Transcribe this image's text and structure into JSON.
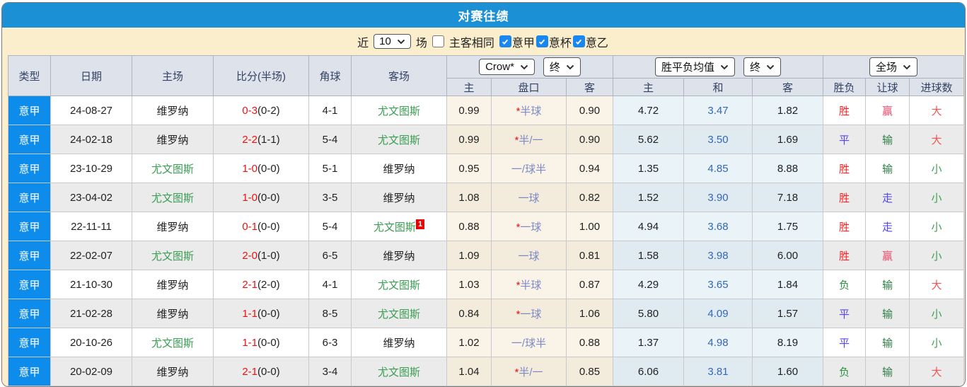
{
  "title": "对赛往绩",
  "filter": {
    "recent_label": "近",
    "count_value": "10",
    "matches_label": "场",
    "same_venue": {
      "label": "主客相同",
      "checked": false
    },
    "leagues": [
      {
        "label": "意甲",
        "checked": true
      },
      {
        "label": "意杯",
        "checked": true
      },
      {
        "label": "意乙",
        "checked": true
      }
    ]
  },
  "table": {
    "headers": {
      "type": "类型",
      "date": "日期",
      "home": "主场",
      "score": "比分(半场)",
      "corners": "角球",
      "away": "客场",
      "odds_company_select": "Crow*",
      "odds_time_select": "终",
      "odds_sub_home": "主",
      "odds_sub_handicap": "盘口",
      "odds_sub_away": "客",
      "avg_select": "胜平负均值",
      "avg_time_select": "终",
      "avg_sub_home": "主",
      "avg_sub_draw": "和",
      "avg_sub_away": "客",
      "scope_select": "全场",
      "result_sub_wl": "胜负",
      "result_sub_handicap": "让球",
      "result_sub_goals": "进球数"
    },
    "rows": [
      {
        "league": "意甲",
        "date": "24-08-27",
        "home": "维罗纳",
        "home_highlight": false,
        "score_ft": "0-3",
        "score_ht": "(0-2)",
        "corners": "4-1",
        "away": "尤文图斯",
        "away_highlight": true,
        "away_note": null,
        "odds_home": "0.99",
        "handicap_star": true,
        "handicap": "半球",
        "odds_away": "0.90",
        "avg_home": "4.72",
        "avg_draw": "3.47",
        "avg_away": "1.82",
        "result": "胜",
        "handicap_result": "赢",
        "goals": "大"
      },
      {
        "league": "意甲",
        "date": "24-02-18",
        "home": "维罗纳",
        "home_highlight": false,
        "score_ft": "2-2",
        "score_ht": "(1-1)",
        "corners": "5-4",
        "away": "尤文图斯",
        "away_highlight": true,
        "away_note": null,
        "odds_home": "0.99",
        "handicap_star": true,
        "handicap": "半/一",
        "odds_away": "0.90",
        "avg_home": "5.62",
        "avg_draw": "3.50",
        "avg_away": "1.69",
        "result": "平",
        "handicap_result": "输",
        "goals": "大"
      },
      {
        "league": "意甲",
        "date": "23-10-29",
        "home": "尤文图斯",
        "home_highlight": true,
        "score_ft": "1-0",
        "score_ht": "(0-0)",
        "corners": "5-1",
        "away": "维罗纳",
        "away_highlight": false,
        "away_note": null,
        "odds_home": "0.95",
        "handicap_star": false,
        "handicap": "一/球半",
        "odds_away": "0.94",
        "avg_home": "1.35",
        "avg_draw": "4.85",
        "avg_away": "8.88",
        "result": "胜",
        "handicap_result": "输",
        "goals": "小"
      },
      {
        "league": "意甲",
        "date": "23-04-02",
        "home": "尤文图斯",
        "home_highlight": true,
        "score_ft": "1-0",
        "score_ht": "(0-0)",
        "corners": "3-5",
        "away": "维罗纳",
        "away_highlight": false,
        "away_note": null,
        "odds_home": "1.08",
        "handicap_star": false,
        "handicap": "一球",
        "odds_away": "0.82",
        "avg_home": "1.52",
        "avg_draw": "3.90",
        "avg_away": "7.18",
        "result": "胜",
        "handicap_result": "走",
        "goals": "小"
      },
      {
        "league": "意甲",
        "date": "22-11-11",
        "home": "维罗纳",
        "home_highlight": false,
        "score_ft": "0-1",
        "score_ht": "(0-0)",
        "corners": "5-4",
        "away": "尤文图斯",
        "away_highlight": true,
        "away_note": "1",
        "odds_home": "0.88",
        "handicap_star": true,
        "handicap": "一球",
        "odds_away": "1.00",
        "avg_home": "4.94",
        "avg_draw": "3.68",
        "avg_away": "1.75",
        "result": "胜",
        "handicap_result": "走",
        "goals": "小"
      },
      {
        "league": "意甲",
        "date": "22-02-07",
        "home": "尤文图斯",
        "home_highlight": true,
        "score_ft": "2-0",
        "score_ht": "(1-0)",
        "corners": "6-5",
        "away": "维罗纳",
        "away_highlight": false,
        "away_note": null,
        "odds_home": "1.09",
        "handicap_star": false,
        "handicap": "一球",
        "odds_away": "0.81",
        "avg_home": "1.58",
        "avg_draw": "3.98",
        "avg_away": "6.00",
        "result": "胜",
        "handicap_result": "赢",
        "goals": "小"
      },
      {
        "league": "意甲",
        "date": "21-10-30",
        "home": "维罗纳",
        "home_highlight": false,
        "score_ft": "2-1",
        "score_ht": "(2-0)",
        "corners": "4-1",
        "away": "尤文图斯",
        "away_highlight": true,
        "away_note": null,
        "odds_home": "1.03",
        "handicap_star": true,
        "handicap": "半球",
        "odds_away": "0.87",
        "avg_home": "4.29",
        "avg_draw": "3.65",
        "avg_away": "1.84",
        "result": "负",
        "handicap_result": "输",
        "goals": "大"
      },
      {
        "league": "意甲",
        "date": "21-02-28",
        "home": "维罗纳",
        "home_highlight": false,
        "score_ft": "1-1",
        "score_ht": "(0-0)",
        "corners": "8-5",
        "away": "尤文图斯",
        "away_highlight": true,
        "away_note": null,
        "odds_home": "0.84",
        "handicap_star": true,
        "handicap": "一球",
        "odds_away": "1.06",
        "avg_home": "5.80",
        "avg_draw": "4.09",
        "avg_away": "1.57",
        "result": "平",
        "handicap_result": "输",
        "goals": "小"
      },
      {
        "league": "意甲",
        "date": "20-10-26",
        "home": "尤文图斯",
        "home_highlight": true,
        "score_ft": "1-1",
        "score_ht": "(0-0)",
        "corners": "6-3",
        "away": "维罗纳",
        "away_highlight": false,
        "away_note": null,
        "odds_home": "1.02",
        "handicap_star": false,
        "handicap": "一/球半",
        "odds_away": "0.88",
        "avg_home": "1.37",
        "avg_draw": "4.98",
        "avg_away": "8.19",
        "result": "平",
        "handicap_result": "输",
        "goals": "小"
      },
      {
        "league": "意甲",
        "date": "20-02-09",
        "home": "维罗纳",
        "home_highlight": false,
        "score_ft": "2-1",
        "score_ht": "(0-0)",
        "corners": "3-4",
        "away": "尤文图斯",
        "away_highlight": true,
        "away_note": null,
        "odds_home": "1.04",
        "handicap_star": true,
        "handicap": "半/一",
        "odds_away": "0.85",
        "avg_home": "6.06",
        "avg_draw": "3.81",
        "avg_away": "1.60",
        "result": "负",
        "handicap_result": "输",
        "goals": "大"
      }
    ]
  },
  "colors": {
    "title_bar_blue": "#1b90d5",
    "filter_bar_cream": "#faeecd",
    "header_bg": "#dee2ea",
    "league_badge_blue": "#0d8ceb",
    "checkbox_checked_blue": "#1a87f0",
    "score_red": "#ee1111",
    "team_highlight_green": "#3a9e52",
    "handicap_text_blue": "#7e88c4",
    "avg_draw_blue": "#3468b4",
    "win_red": "#ff2222",
    "draw_blue": "#5544f5",
    "lose_green": "#2f9242",
    "handicap_win_pink": "#f04a6a",
    "push_blue": "#5544f5",
    "handicap_lose_green": "#2f7d46",
    "over_red": "#f55555",
    "under_green": "#3fa055",
    "odds_cell_cream": "#faf4e8",
    "avg_cell_lightblue": "#e9f3f8",
    "row_alt_gray": "#ebebeb"
  }
}
